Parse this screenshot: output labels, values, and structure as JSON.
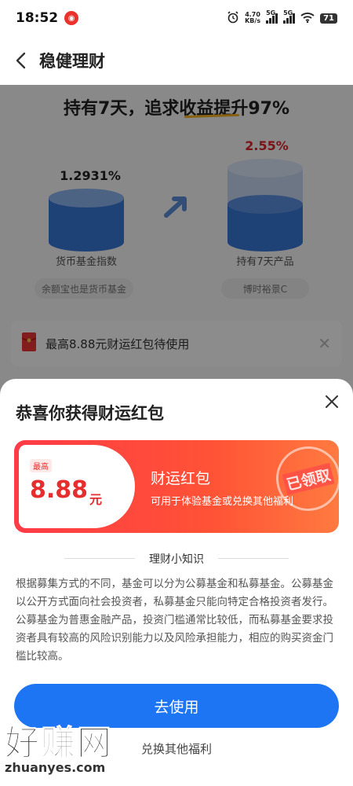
{
  "status_bar": {
    "time": "18:52",
    "app_icon": "weibo-icon",
    "speed_value": "4.70",
    "speed_unit": "KB/s",
    "network1": "5G",
    "network2": "5G",
    "battery": "71"
  },
  "nav": {
    "title": "稳健理财",
    "back_icon": "chevron-left-icon"
  },
  "page": {
    "headline": "持有7天，追求收益提升97%",
    "left": {
      "rate": "1.2931%",
      "label": "货币基金指数",
      "pill": "余额宝也是货币基金"
    },
    "right": {
      "rate": "2.55%",
      "label": "持有7天产品",
      "pill": "博时裕景C"
    },
    "notice": {
      "text": "最高8.88元财运红包待使用"
    }
  },
  "sheet": {
    "title": "恭喜你获得财运红包",
    "coupon": {
      "tag": "最高",
      "amount": "8.88",
      "unit": "元",
      "name": "财运红包",
      "desc": "可用于体验基金或兑换其他福利",
      "stamp": "已领取"
    },
    "tips_title": "理财小知识",
    "tips_body": "根据募集方式的不同，基金可以分为公募基金和私募基金。公募基金以公开方式面向社会投资者，私募基金只能向特定合格投资者发行。公募基金为普惠金融产品，投资门槛通常比较低，而私募基金要求投资者具有较高的风险识别能力以及风险承担能力，相应的购买资金门槛比较高。",
    "use_button": "去使用",
    "exchange_link": "兑换其他福利"
  },
  "watermark": {
    "big": "好赚网",
    "small": "zhuanyes.com"
  },
  "colors": {
    "primary_blue": "#1e75f3",
    "coupon_red": "#ff3b47",
    "rate_red": "#e0232b",
    "accent_yellow": "#f7b21e"
  }
}
